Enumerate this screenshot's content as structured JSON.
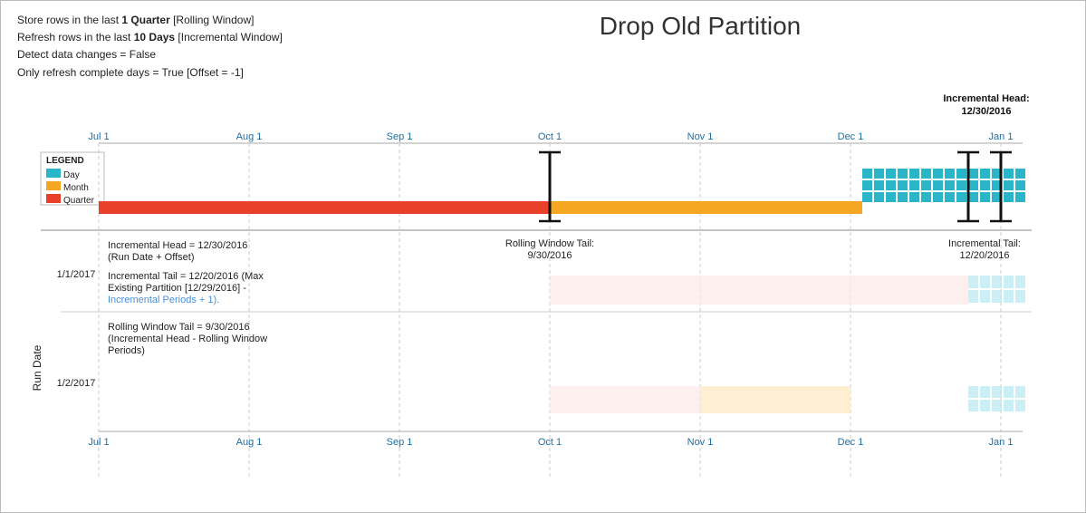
{
  "title": "Drop Old Partition",
  "info": {
    "line1_prefix": "Store rows in the last ",
    "line1_bold": "1 Quarter",
    "line1_suffix": " [Rolling Window]",
    "line2_prefix": "Refresh rows in the last ",
    "line2_bold": "10 Days",
    "line2_suffix": " [Incremental Window]",
    "line3": "Detect data changes = False",
    "line4": "Only refresh complete days = True [Offset = -1]"
  },
  "legend": {
    "title": "LEGEND",
    "items": [
      {
        "label": "Day",
        "color": "#2ab5c8"
      },
      {
        "label": "Month",
        "color": "#f5a623"
      },
      {
        "label": "Quarter",
        "color": "#e8402a"
      }
    ]
  },
  "axis": {
    "labels": [
      "Jul 1",
      "Aug 1",
      "Sep 1",
      "Oct 1",
      "Nov 1",
      "Dec 1",
      "Jan 1"
    ]
  },
  "incremental_head_label": "Incremental Head:\n12/30/2016",
  "annotations": {
    "incremental_head": "Incremental Head = 12/30/2016\n(Run Date + Offset)",
    "incremental_tail": "Incremental Tail = 12/20/2016 (Max\nExisting Partition [12/29/2016] -\nIncremental Periods + 1).",
    "rolling_window_tail": "Rolling Window Tail = 9/30/2016\n(Incremental Head - Rolling Window\nPeriods)",
    "rolling_window_tail_label": "Rolling Window Tail:\n9/30/2016",
    "incremental_tail_label": "Incremental Tail:\n12/20/2016",
    "run_date": "Run Date",
    "run_date_1": "1/1/2017",
    "run_date_2": "1/2/2017"
  },
  "colors": {
    "day": "#2ab5c8",
    "month": "#f5a623",
    "quarter": "#e8402a",
    "day_light": "#b3e8f0",
    "month_light": "#fde8c0",
    "teal_grid": "#2ab5c8",
    "axis_color": "#1a6ea8"
  }
}
